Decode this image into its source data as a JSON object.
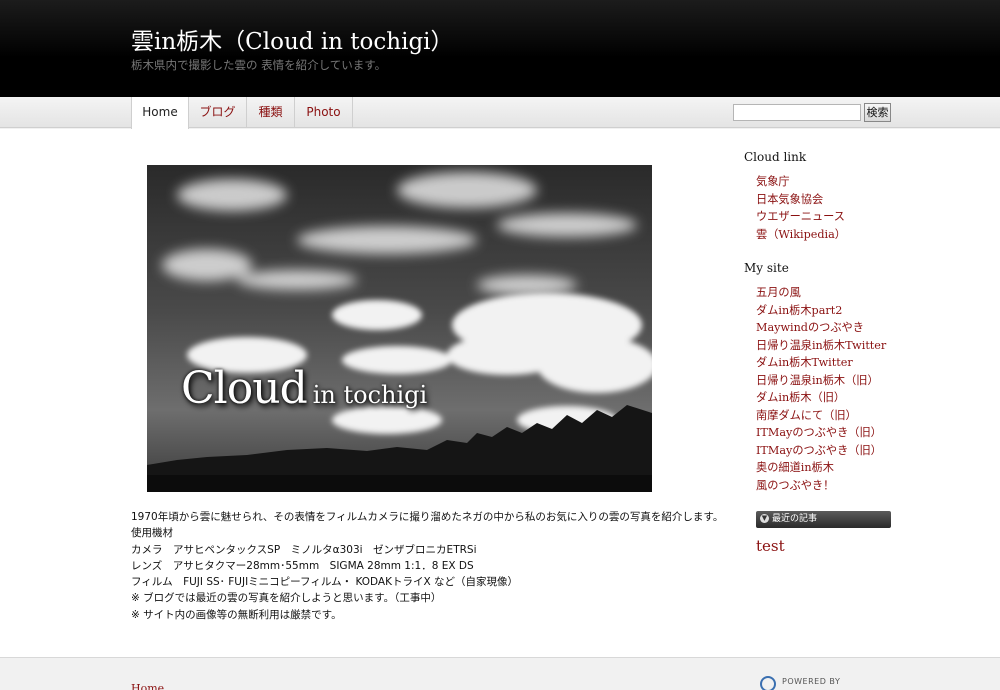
{
  "header": {
    "title": "雲in栃木（Cloud in tochigi）",
    "description": "栃木県内で撮影した雲の 表情を紹介しています。"
  },
  "nav": {
    "tabs": [
      {
        "label": "Home"
      },
      {
        "label": "ブログ"
      },
      {
        "label": "種類"
      },
      {
        "label": "Photo"
      }
    ],
    "search_value": "",
    "search_button": "検索"
  },
  "hero": {
    "title_big": "Cloud",
    "title_small": "in tochigi"
  },
  "intro": {
    "lines": [
      "1970年頃から雲に魅せられ、その表情をフィルムカメラに撮り溜めたネガの中から私のお気に入りの雲の写真を紹介します。",
      "使用機材",
      "カメラ　アサヒペンタックスSP　ミノルタα303i　ゼンザブロニカETRSi",
      "レンズ　アサヒタクマー28mm･55mm　SIGMA 28mm 1:1．8 EX DS",
      "フィルム　FUJI SS･ FUJIミニコピーフィルム・ KODAKトライX など（自家現像）",
      "※ ブログでは最近の雲の写真を紹介しようと思います。（工事中）",
      "※ サイト内の画像等の無断利用は厳禁です。"
    ]
  },
  "sidebar": {
    "cloud_link": {
      "heading": "Cloud link",
      "items": [
        "気象庁",
        "日本気象協会",
        "ウエザーニュース",
        "雲（Wikipedia）"
      ]
    },
    "my_site": {
      "heading": "My site",
      "items": [
        "五月の風",
        "ダムin栃木part2",
        "Maywindのつぶやき",
        "日帰り温泉in栃木Twitter",
        "ダムin栃木Twitter",
        "日帰り温泉in栃木（旧）",
        "ダムin栃木（旧）",
        "南摩ダムにて（旧）",
        "ITMayのつぶやき（旧）",
        "ITMayのつぶやき（旧）",
        "奥の細道in栃木",
        "風のつぶやき！"
      ]
    },
    "recent": {
      "heading": "最近の記事",
      "post": "test"
    }
  },
  "footer": {
    "home_link": "Home",
    "powered_by": "POWERED BY"
  },
  "colors": {
    "link": "#8a1010",
    "header_bg": "#000000"
  }
}
